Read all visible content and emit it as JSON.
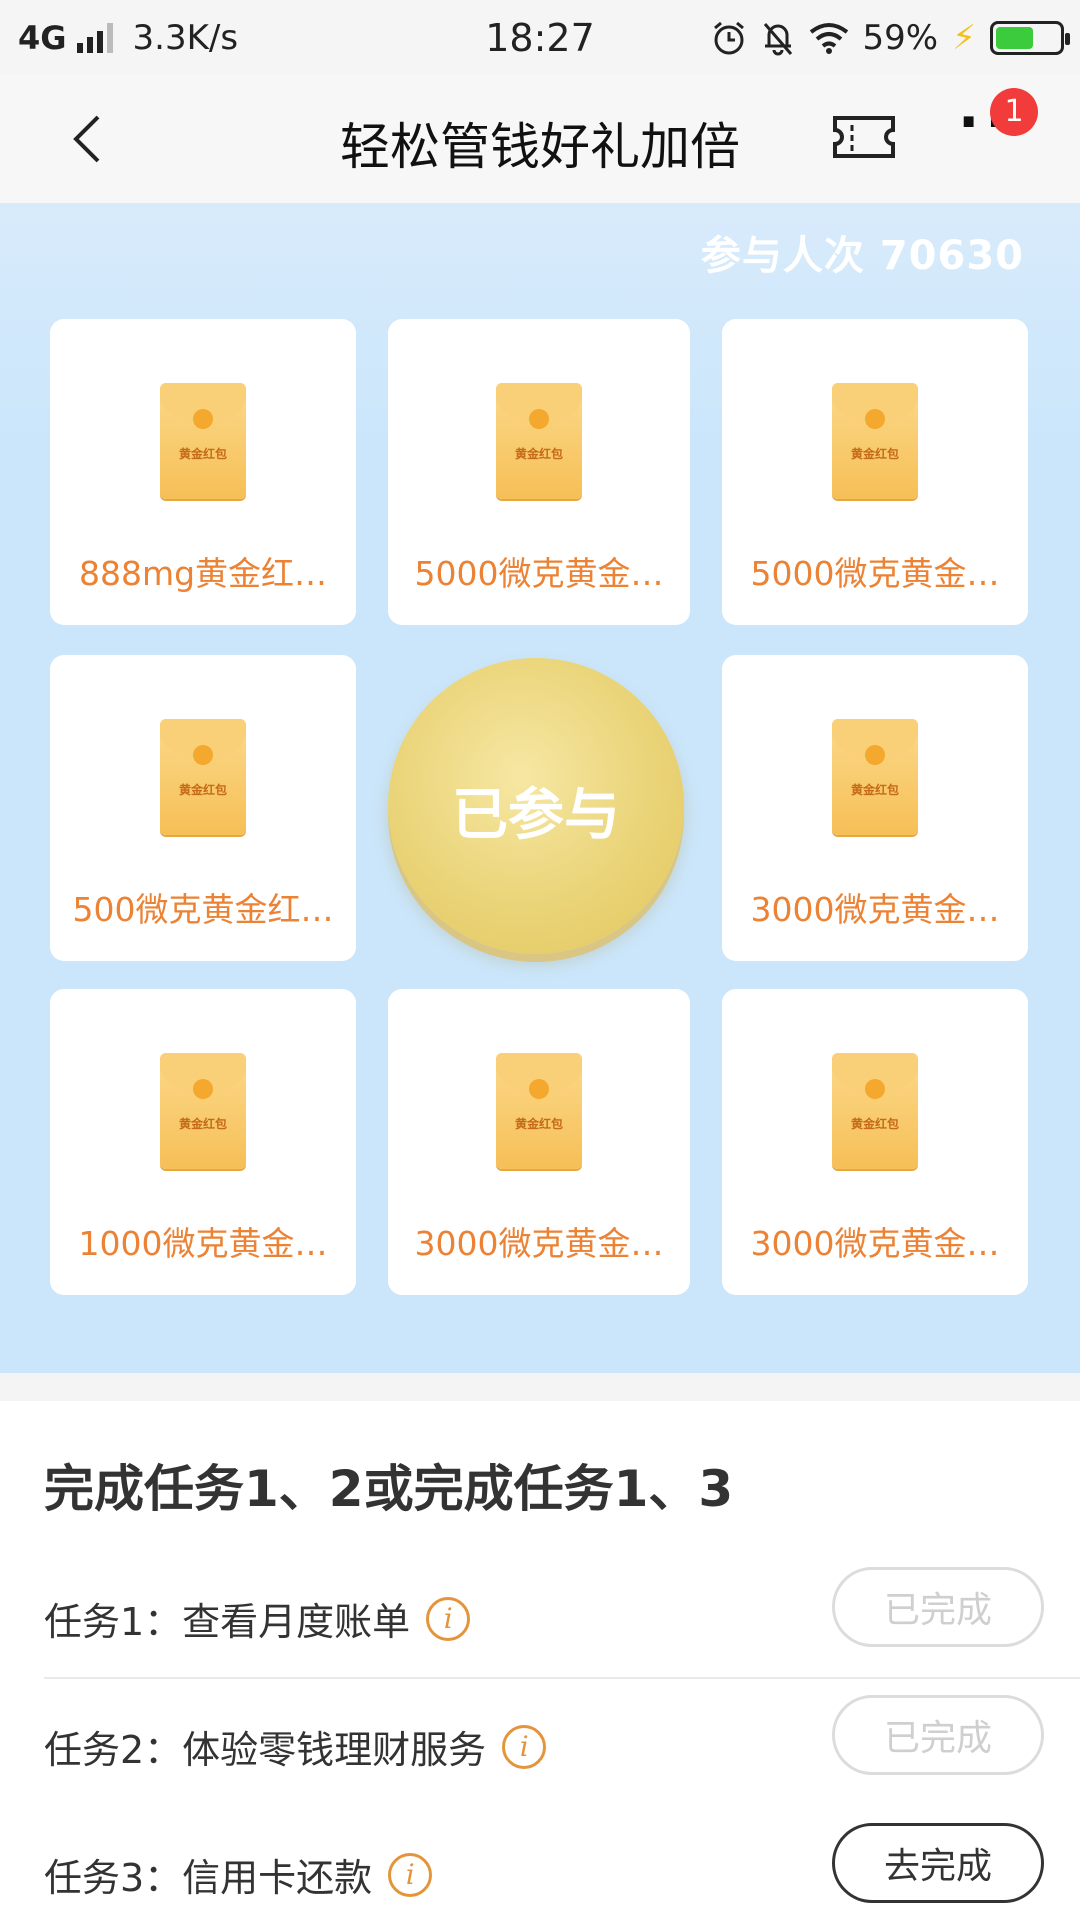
{
  "status_bar": {
    "network": "4G",
    "speed": "3.3K/s",
    "time": "18:27",
    "battery_text": "59%",
    "battery_level": 0.59
  },
  "nav": {
    "title": "轻松管钱好礼加倍",
    "badge_count": "1"
  },
  "lottery": {
    "participants": "参与人次 70630",
    "envelope_text": "黄金红包",
    "center_button": "已参与",
    "prizes": [
      "888mg黄金红…",
      "5000微克黄金…",
      "5000微克黄金…",
      "500微克黄金红…",
      "3000微克黄金…",
      "1000微克黄金…",
      "3000微克黄金…",
      "3000微克黄金…"
    ]
  },
  "tasks": {
    "title": "完成任务1、2或完成任务1、3",
    "items": [
      {
        "label": "任务1：查看月度账单",
        "button": "已完成"
      },
      {
        "label": "任务2：体验零钱理财服务",
        "button": "已完成"
      },
      {
        "label": "任务3：信用卡还款",
        "button": "去完成"
      }
    ]
  },
  "colors": {
    "accent_orange": "#ec8234",
    "background_blue": "#cbe6fb",
    "badge_red": "#f23b3b"
  }
}
